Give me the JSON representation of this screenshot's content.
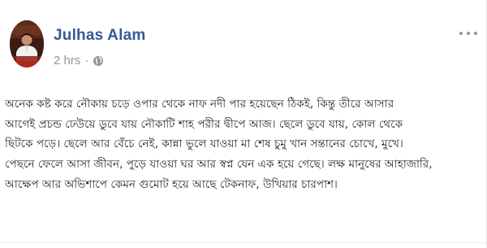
{
  "post": {
    "author_name": "Julhas Alam",
    "timestamp": "2 hrs",
    "separator": "·",
    "privacy_icon": "globe-icon",
    "more_icon": "more-options-icon",
    "text_lines": [
      "অনেক কষ্ট করে নৌকায় চড়ে ওপার থেকে নাফ নদী পার হয়েছেন ঠিকই, কিন্তু তীরে আসার",
      "আগেই প্রচন্ড ঢেউয়ে ডুবে যায় নৌকাটি শাহ পরীর দ্বীপে আজ। ছেলে ডুবে যায়, কোল থেকে",
      "ছিটকে পড়ে। ছেলে আর বেঁচে নেই, কান্না ভুলে যাওয়া মা শেষ চুমু খান সন্তানের চোখে, মুখে।",
      "পেছনে ফেলে আসা জীবন, পুড়ে যাওয়া ঘর আর স্বপ্ন যেন এক হয়ে গেছে। লক্ষ মানুষের আহাজারি,",
      "আক্ষেপ আর অভিশাপে কেমন গুমোট হয়ে আছে টেকনাফ, উখিয়ার চারপাশ।"
    ]
  },
  "colors": {
    "author_link": "#365899",
    "meta_text": "#90949c",
    "body_text": "#1d2129"
  }
}
